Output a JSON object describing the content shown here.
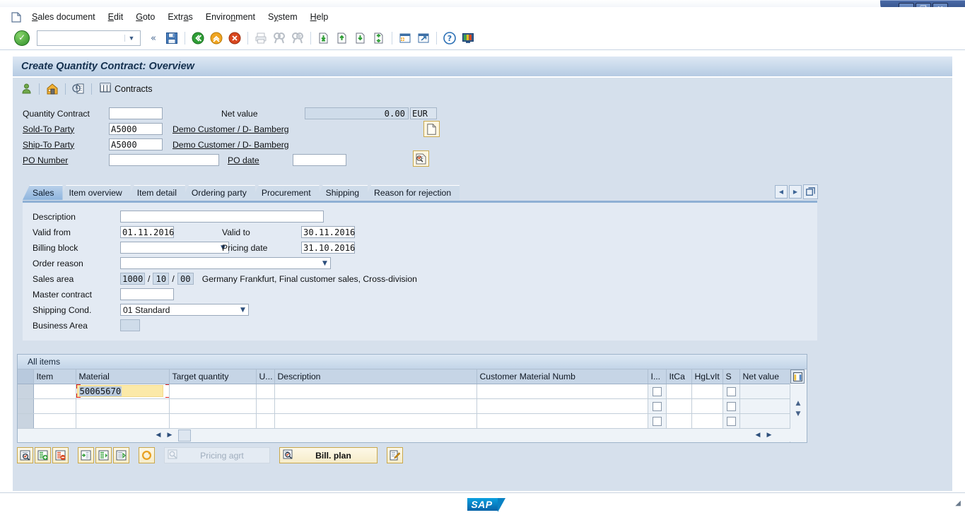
{
  "window": {
    "minimize_label": "–",
    "maximize_label": "❐",
    "close_label": "✕"
  },
  "menubar": {
    "doc_icon": "document-icon",
    "items": [
      {
        "label": "Sales document",
        "accel": "S"
      },
      {
        "label": "Edit",
        "accel": "E"
      },
      {
        "label": "Goto",
        "accel": "G"
      },
      {
        "label": "Extras",
        "accel": "a"
      },
      {
        "label": "Environment",
        "accel": "n"
      },
      {
        "label": "System",
        "accel": "y"
      },
      {
        "label": "Help",
        "accel": "H"
      }
    ]
  },
  "toolbar": {
    "ok_icon": "check-circle-icon",
    "command_value": "",
    "command_placeholder": "",
    "dropdown_arrow": "▼",
    "back_chevron": "«",
    "icons": [
      "save-icon",
      "back-icon",
      "exit-icon",
      "cancel-icon",
      "print-icon",
      "find-icon",
      "find-next-icon",
      "first-page-icon",
      "previous-page-icon",
      "next-page-icon",
      "last-page-icon",
      "create-session-icon",
      "create-shortcut-icon",
      "help-icon",
      "customize-local-layout-icon"
    ]
  },
  "screen": {
    "title": "Create Quantity Contract: Overview"
  },
  "app_toolbar": {
    "icons": [
      "partner-icon",
      "sold-to-party-icon",
      "document-header-icon"
    ],
    "contracts_button": {
      "label": "Contracts",
      "icon": "contracts-table-icon"
    }
  },
  "header": {
    "quantity_contract": {
      "label": "Quantity Contract",
      "value": ""
    },
    "net_value": {
      "label": "Net value",
      "value": "0.00",
      "currency": "EUR"
    },
    "sold_to_party": {
      "label": "Sold-To Party",
      "value": "A5000",
      "description": "Demo Customer / D- Bamberg"
    },
    "ship_to_party": {
      "label": "Ship-To Party",
      "value": "A5000",
      "description": "Demo Customer / D- Bamberg"
    },
    "po_number": {
      "label": "PO Number",
      "value": ""
    },
    "po_date": {
      "label": "PO date",
      "value": ""
    },
    "open_document_icon": "open-document-icon",
    "display_doc_header_icon": "display-document-header-icon"
  },
  "tabs": {
    "items": [
      {
        "label": "Sales",
        "active": true
      },
      {
        "label": "Item overview",
        "active": false
      },
      {
        "label": "Item detail",
        "active": false
      },
      {
        "label": "Ordering party",
        "active": false
      },
      {
        "label": "Procurement",
        "active": false
      },
      {
        "label": "Shipping",
        "active": false
      },
      {
        "label": "Reason for rejection",
        "active": false
      }
    ],
    "nav_prev": "◀",
    "nav_next": "▶",
    "nav_list": "❐"
  },
  "sales_tab": {
    "description": {
      "label": "Description",
      "value": ""
    },
    "valid_from": {
      "label": "Valid from",
      "value": "01.11.2016"
    },
    "valid_to": {
      "label": "Valid to",
      "value": "30.11.2016"
    },
    "billing_block": {
      "label": "Billing block",
      "value": ""
    },
    "pricing_date": {
      "label": "Pricing date",
      "value": "31.10.2016"
    },
    "order_reason": {
      "label": "Order reason",
      "value": ""
    },
    "sales_area": {
      "label": "Sales area",
      "sales_org": "1000",
      "distribution_channel": "10",
      "division": "00",
      "separator": "/",
      "description": "Germany Frankfurt, Final customer sales, Cross-division"
    },
    "master_contract": {
      "label": "Master contract",
      "value": ""
    },
    "shipping_cond": {
      "label": "Shipping Cond.",
      "value": "01 Standard"
    },
    "business_area": {
      "label": "Business Area",
      "value": ""
    }
  },
  "items_table": {
    "title": "All items",
    "columns": [
      {
        "key": "sel",
        "label": ""
      },
      {
        "key": "item",
        "label": "Item"
      },
      {
        "key": "material",
        "label": "Material"
      },
      {
        "key": "target_quantity",
        "label": "Target quantity"
      },
      {
        "key": "unit",
        "label": "U..."
      },
      {
        "key": "description",
        "label": "Description"
      },
      {
        "key": "customer_material",
        "label": "Customer Material Numb"
      },
      {
        "key": "i",
        "label": "I..."
      },
      {
        "key": "itca",
        "label": "ItCa"
      },
      {
        "key": "hglvit",
        "label": "HgLvIt"
      },
      {
        "key": "s",
        "label": "S"
      },
      {
        "key": "net_value",
        "label": "Net value"
      }
    ],
    "rows": [
      {
        "item": "",
        "material": "50065670",
        "material_selected": true,
        "target_quantity": "",
        "unit": "",
        "description": "",
        "customer_material": "",
        "i": false,
        "itca": "",
        "hglvit": "",
        "s": false,
        "net_value": ""
      },
      {
        "item": "",
        "material": "",
        "material_selected": false,
        "target_quantity": "",
        "unit": "",
        "description": "",
        "customer_material": "",
        "i": false,
        "itca": "",
        "hglvit": "",
        "s": false,
        "net_value": ""
      },
      {
        "item": "",
        "material": "",
        "material_selected": false,
        "target_quantity": "",
        "unit": "",
        "description": "",
        "customer_material": "",
        "i": false,
        "itca": "",
        "hglvit": "",
        "s": false,
        "net_value": ""
      }
    ],
    "search_help_icon": "search-help-icon",
    "column_config_icon": "column-configuration-icon",
    "scroll_left": "◀",
    "scroll_right": "▶",
    "scroll_up": "▲",
    "scroll_down": "▼"
  },
  "bottom_buttons": {
    "icon_buttons": [
      "display-item-details-icon",
      "insert-item-icon",
      "delete-item-icon",
      "item-conditions-icon",
      "configuration-icon",
      "availability-icon",
      "refresh-icon"
    ],
    "pricing_agreement": {
      "label": "Pricing agrt",
      "icon": "pricing-agreement-icon",
      "enabled": false
    },
    "billing_plan": {
      "label": "Bill. plan",
      "icon": "billing-plan-icon",
      "enabled": true
    },
    "edit_text_icon": "edit-text-icon"
  },
  "status_bar": {
    "logo": "SAP",
    "resize_grip": "resize-grip-icon"
  },
  "colors": {
    "brand_blue": "#0a8fd4",
    "content_bg": "#d6e0ec",
    "title_bg": "#b6cbe3",
    "focus_yellow": "#fbe9a8",
    "focus_red": "#e02020",
    "button_gold": "#c9a84c"
  }
}
